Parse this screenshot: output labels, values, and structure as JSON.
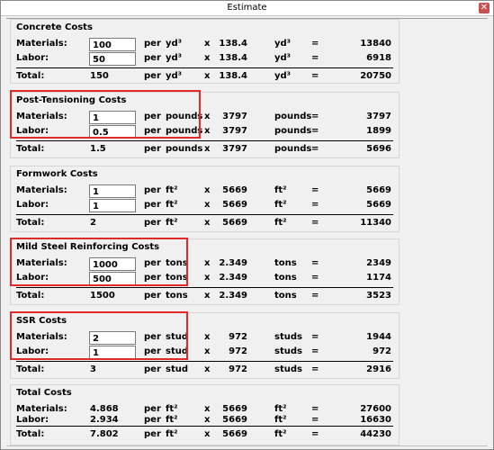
{
  "window": {
    "title": "Estimate",
    "close_glyph": "✕"
  },
  "concrete": {
    "title": "Concrete Costs",
    "materials": {
      "label": "Materials:",
      "value": "100",
      "per": "per",
      "unit": "yd³",
      "x": "x",
      "mult": "138.4",
      "unit2": "yd³",
      "eq": "=",
      "result": "13840"
    },
    "labor": {
      "label": "Labor:",
      "value": "50",
      "per": "per",
      "unit": "yd³",
      "x": "x",
      "mult": "138.4",
      "unit2": "yd³",
      "eq": "=",
      "result": "6918"
    },
    "total": {
      "label": "Total:",
      "value": "150",
      "per": "per",
      "unit": "yd³",
      "x": "x",
      "mult": "138.4",
      "unit2": "yd³",
      "eq": "=",
      "result": "20750"
    }
  },
  "post_tensioning": {
    "title": "Post-Tensioning Costs",
    "materials": {
      "label": "Materials:",
      "value": "1",
      "per": "per",
      "unit": "pounds",
      "x": "x",
      "mult": "3797",
      "unit2": "pounds",
      "eq": "=",
      "result": "3797"
    },
    "labor": {
      "label": "Labor:",
      "value": "0.5",
      "per": "per",
      "unit": "pounds",
      "x": "x",
      "mult": "3797",
      "unit2": "pounds",
      "eq": "=",
      "result": "1899"
    },
    "total": {
      "label": "Total:",
      "value": "1.5",
      "per": "per",
      "unit": "pounds",
      "x": "x",
      "mult": "3797",
      "unit2": "pounds",
      "eq": "=",
      "result": "5696"
    }
  },
  "formwork": {
    "title": "Formwork Costs",
    "materials": {
      "label": "Materials:",
      "value": "1",
      "per": "per",
      "unit": "ft²",
      "x": "x",
      "mult": "5669",
      "unit2": "ft²",
      "eq": "=",
      "result": "5669"
    },
    "labor": {
      "label": "Labor:",
      "value": "1",
      "per": "per",
      "unit": "ft²",
      "x": "x",
      "mult": "5669",
      "unit2": "ft²",
      "eq": "=",
      "result": "5669"
    },
    "total": {
      "label": "Total:",
      "value": "2",
      "per": "per",
      "unit": "ft²",
      "x": "x",
      "mult": "5669",
      "unit2": "ft²",
      "eq": "=",
      "result": "11340"
    }
  },
  "mild_steel": {
    "title": "Mild Steel Reinforcing Costs",
    "materials": {
      "label": "Materials:",
      "value": "1000",
      "per": "per",
      "unit": "tons",
      "x": "x",
      "mult": "2.349",
      "unit2": "tons",
      "eq": "=",
      "result": "2349"
    },
    "labor": {
      "label": "Labor:",
      "value": "500",
      "per": "per",
      "unit": "tons",
      "x": "x",
      "mult": "2.349",
      "unit2": "tons",
      "eq": "=",
      "result": "1174"
    },
    "total": {
      "label": "Total:",
      "value": "1500",
      "per": "per",
      "unit": "tons",
      "x": "x",
      "mult": "2.349",
      "unit2": "tons",
      "eq": "=",
      "result": "3523"
    }
  },
  "ssr": {
    "title": "SSR Costs",
    "materials": {
      "label": "Materials:",
      "value": "2",
      "per": "per",
      "unit": "stud",
      "x": "x",
      "mult": "972",
      "unit2": "studs",
      "eq": "=",
      "result": "1944"
    },
    "labor": {
      "label": "Labor:",
      "value": "1",
      "per": "per",
      "unit": "stud",
      "x": "x",
      "mult": "972",
      "unit2": "studs",
      "eq": "=",
      "result": "972"
    },
    "total": {
      "label": "Total:",
      "value": "3",
      "per": "per",
      "unit": "stud",
      "x": "x",
      "mult": "972",
      "unit2": "studs",
      "eq": "=",
      "result": "2916"
    }
  },
  "total_costs": {
    "title": "Total Costs",
    "materials": {
      "label": "Materials:",
      "value": "4.868",
      "per": "per",
      "unit": "ft²",
      "x": "x",
      "mult": "5669",
      "unit2": "ft²",
      "eq": "=",
      "result": "27600"
    },
    "labor": {
      "label": "Labor:",
      "value": "2.934",
      "per": "per",
      "unit": "ft²",
      "x": "x",
      "mult": "5669",
      "unit2": "ft²",
      "eq": "=",
      "result": "16630"
    },
    "total": {
      "label": "Total:",
      "value": "7.802",
      "per": "per",
      "unit": "ft²",
      "x": "x",
      "mult": "5669",
      "unit2": "ft²",
      "eq": "=",
      "result": "44230"
    }
  },
  "colors": {
    "highlight": "#e02a2a",
    "close": "#c75050"
  }
}
